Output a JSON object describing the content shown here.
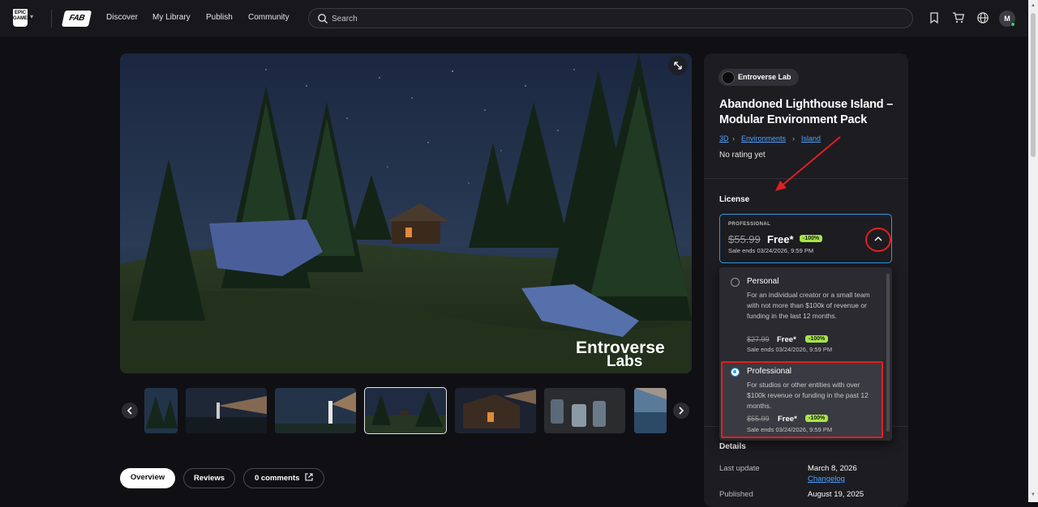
{
  "header": {
    "epic_logo_text": "EPIC GAMES",
    "fab_logo_text": "FAB",
    "nav": [
      "Discover",
      "My Library",
      "Publish",
      "Community"
    ],
    "search_placeholder": "Search",
    "avatar_initial": "M",
    "icons": [
      "bookmark-icon",
      "cart-icon",
      "globe-icon"
    ]
  },
  "gallery": {
    "hero_watermark_line1": "Entroverse",
    "hero_watermark_line2": "Labs",
    "thumb_watermark": "Entroverse Labs",
    "thumbnail_count": 7,
    "selected_thumbnail": 4
  },
  "tabs": {
    "overview": "Overview",
    "reviews": "Reviews",
    "comments": "0 comments"
  },
  "product": {
    "seller": "Entroverse Lab",
    "title": "Abandoned Lighthouse Island – Modular Environment Pack",
    "breadcrumbs": [
      "3D",
      "Environments",
      "Island"
    ],
    "rating": "No rating yet"
  },
  "license": {
    "label": "License",
    "selected": {
      "tier": "PROFESSIONAL",
      "old_price": "$55.99",
      "price": "Free*",
      "discount": "-100%",
      "sale_text": "Sale ends 03/24/2026, 9:59 PM"
    },
    "options": [
      {
        "name": "Personal",
        "description": "For an individual creator or a small team with not more than $100k of revenue or funding in the last 12 months.",
        "old_price": "$27.99",
        "price": "Free*",
        "discount": "-100%",
        "sale_text": "Sale ends 03/24/2026, 9:59 PM",
        "checked": false
      },
      {
        "name": "Professional",
        "description": "For studios or other entities with over $100k revenue or funding in the past 12 months.",
        "old_price": "$55.99",
        "price": "Free*",
        "discount": "-100%",
        "sale_text": "Sale ends 03/24/2026, 9:59 PM",
        "checked": true
      }
    ]
  },
  "details": {
    "title": "Details",
    "last_update_label": "Last update",
    "last_update_value": "March 8, 2026",
    "changelog": "Changelog",
    "published_label": "Published",
    "published_value": "August 19, 2025"
  },
  "colors": {
    "accent_blue": "#2e9be6",
    "discount_green": "#a8e54a",
    "annotation_red": "#e02020",
    "background": "#101014"
  }
}
